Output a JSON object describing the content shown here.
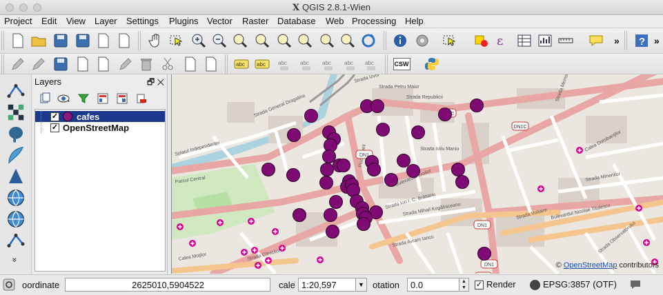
{
  "window": {
    "title": "QGIS 2.8.1-Wien",
    "app_glyph": "X"
  },
  "menu": [
    "Project",
    "Edit",
    "View",
    "Layer",
    "Settings",
    "Plugins",
    "Vector",
    "Raster",
    "Database",
    "Web",
    "Processing",
    "Help"
  ],
  "toolbar1_icons": [
    "new-project-icon",
    "open-project-icon",
    "save-project-icon",
    "save-as-icon",
    "new-print-composer-icon",
    "composer-manager-icon",
    "pan-icon",
    "pan-to-selection-icon",
    "zoom-in-icon",
    "zoom-out-icon",
    "zoom-actual-icon",
    "zoom-full-icon",
    "zoom-to-selection-icon",
    "zoom-to-layer-icon",
    "zoom-last-icon",
    "zoom-next-icon",
    "refresh-icon",
    "identify-icon",
    "action-icon",
    "select-icon",
    "deselect-icon",
    "expression-select-icon",
    "attribute-table-icon",
    "statistics-icon",
    "measure-icon",
    "map-tips-icon",
    "help-icon"
  ],
  "toolbar2_icons": [
    "current-edits-icon",
    "toggle-editing-icon",
    "save-edits-icon",
    "add-feature-icon",
    "move-feature-icon",
    "node-tool-icon",
    "delete-selected-icon",
    "cut-features-icon",
    "copy-features-icon",
    "paste-features-icon",
    "label-icon",
    "label-highlight-icon",
    "pin-labels-icon",
    "show-hide-labels-icon",
    "move-label-icon",
    "rotate-label-icon",
    "change-label-icon",
    "csw-icon",
    "python-console-icon"
  ],
  "csw_label": "CSW",
  "label_text": "abc",
  "more_glyph": "»",
  "left_toolbar_icons": [
    "add-vector-layer-icon",
    "add-raster-layer-icon",
    "add-postgis-layer-icon",
    "add-spatialite-layer-icon",
    "add-mssql-layer-icon",
    "add-wms-layer-icon",
    "add-wcs-layer-icon",
    "add-wfs-layer-icon"
  ],
  "left_toolbar_more": "»",
  "layers_panel": {
    "title": "Layers",
    "controls": "🗗 ✕",
    "items": [
      {
        "name": "cafes",
        "checked": true,
        "selected": true,
        "symbol_color": "#8b1a7f"
      },
      {
        "name": "OpenStreetMap",
        "checked": true,
        "selected": false
      }
    ],
    "check_glyph": "✓"
  },
  "map": {
    "attribution_prefix": "© ",
    "attribution_link": "OpenStreetMap",
    "attribution_suffix": " contributors",
    "street_labels": [
      "Strada Izvor",
      "Splaiul Independenţei",
      "Strada General Dragalina",
      "Parcul Central",
      "Calea Dorobanţilor",
      "Strada Ion I. C. Brătianu",
      "Bulevardul Eroilor",
      "Piata Unirii",
      "Strada Avram Iancu",
      "Calea Moţilor",
      "Bulevardul Nicolae Titulescu",
      "Strada Voltaire",
      "Strada Observatorului",
      "Strada Memorandumului",
      "Strada Iuliu Maniu",
      "Strada Mihail Kogălniceanu",
      "Strada Clinicilor",
      "Strada Petru Maior",
      "Strada Republicii",
      "Strada Mineriilor"
    ],
    "road_shields": [
      "DN1C",
      "DN1C",
      "DN1",
      "DN1",
      "DN1",
      "DN1"
    ],
    "cafe_color": "#800a73"
  },
  "status": {
    "coordinate_label": "oordinate",
    "coordinate_value": "2625010,5904522",
    "scale_label": "cale",
    "scale_value": "1:20,597",
    "rotation_label": "otation",
    "rotation_value": "0.0",
    "render_label": "Render",
    "render_checked": true,
    "crs_label": "EPSG:3857 (OTF)"
  }
}
